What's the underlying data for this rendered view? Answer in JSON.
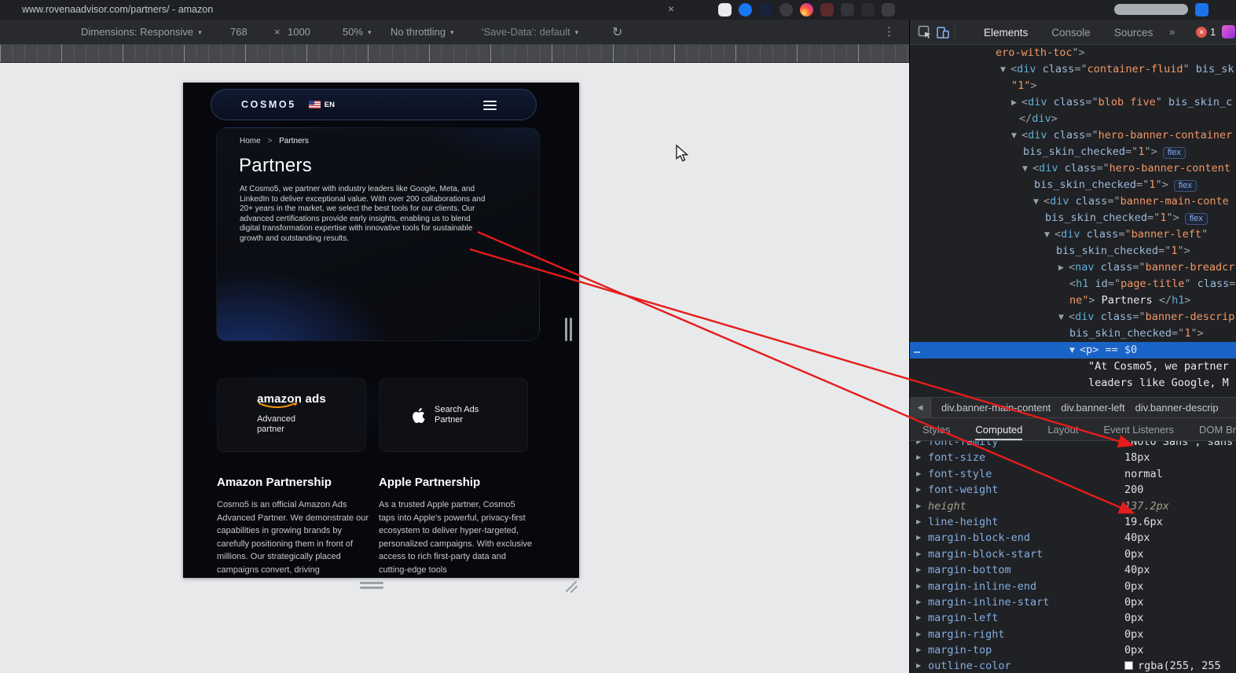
{
  "browser": {
    "tab_title": "www.rovenaadvisor.com/partners/ - amazon",
    "toolbar_icons": [
      {
        "name": "extension-icon-1",
        "color": "#e8eaed",
        "shape": "rounded"
      },
      {
        "name": "extension-icon-2",
        "color": "#1877f2",
        "shape": "circle"
      },
      {
        "name": "extension-icon-3",
        "color": "#16233a",
        "shape": "rounded"
      },
      {
        "name": "extension-icon-4",
        "color": "#3a3b3e",
        "shape": "circle"
      },
      {
        "name": "extension-icon-5",
        "color": "insta",
        "shape": "circle"
      },
      {
        "name": "extension-icon-6",
        "color": "#5c2a2a",
        "shape": "rounded"
      },
      {
        "name": "extension-icon-7",
        "color": "#33343a",
        "shape": "rounded"
      },
      {
        "name": "extension-icon-8",
        "color": "#2b2c30",
        "shape": "rounded"
      },
      {
        "name": "extension-icon-9",
        "color": "#3c3d41",
        "shape": "rounded"
      }
    ]
  },
  "icons": {
    "close": "×",
    "caret": "▾",
    "times": "×",
    "rotate": "↻",
    "menu_dots": "⋮",
    "more_tabs": "»",
    "back_arrow": "◀",
    "gutter_ellipsis": "…",
    "error_x": "✕"
  },
  "device_toolbar": {
    "dimensions_label": "Dimensions: Responsive",
    "width": "768",
    "height": "1000",
    "zoom": "50%",
    "throttling": "No throttling",
    "save_data": "'Save-Data': default"
  },
  "page": {
    "logo": "COSMO5",
    "flag_label": "EN",
    "breadcrumb": {
      "home": "Home",
      "separator": ">",
      "current": "Partners"
    },
    "title": "Partners",
    "intro": "At Cosmo5, we partner with industry leaders like Google, Meta, and LinkedIn to deliver exceptional value. With over 200 collaborations and 20+ years in the market, we select the best tools for our clients. Our advanced certifications provide early insights, enabling us to blend digital transformation expertise with innovative tools for sustainable growth and outstanding results.",
    "partner_cards": [
      {
        "logo_text": "amazon ads",
        "label": "Advanced partner"
      },
      {
        "logo_icon": "apple-logo",
        "label": "Search Ads Partner"
      }
    ],
    "sections": [
      {
        "heading": "Amazon Partnership",
        "body": "Cosmo5 is an official Amazon Ads Advanced Partner. We demonstrate our capabilities in growing brands by carefully positioning them in front of millions. Our strategically placed campaigns convert, driving"
      },
      {
        "heading": "Apple Partnership",
        "body": "As a trusted Apple partner, Cosmo5 taps into Apple's powerful, privacy-first ecosystem to deliver hyper-targeted, personalized campaigns. With exclusive access to rich first-party data and cutting-edge tools"
      }
    ]
  },
  "devtools": {
    "panel_tabs": [
      "Elements",
      "Console",
      "Sources"
    ],
    "selected_panel_tab": "Elements",
    "error_count": "1",
    "dom_lines": [
      {
        "indent": 109,
        "parts": [
          [
            "val",
            "ero-with-toc"
          ],
          [
            "p",
            "\">"
          ]
        ]
      },
      {
        "indent": 115,
        "parts": [
          [
            "sym",
            "▼"
          ],
          [
            "p",
            "<"
          ],
          [
            "tag",
            "div"
          ],
          [
            "p",
            " "
          ],
          [
            "attr",
            "class"
          ],
          [
            "p",
            "=\""
          ],
          [
            "val",
            "container-fluid"
          ],
          [
            "p",
            "\" "
          ],
          [
            "attr",
            "bis_sk"
          ]
        ]
      },
      {
        "indent": 129,
        "parts": [
          [
            "val",
            "\"1\""
          ],
          [
            "p",
            ">"
          ]
        ]
      },
      {
        "indent": 129,
        "parts": [
          [
            "sym",
            "▶"
          ],
          [
            "p",
            "<"
          ],
          [
            "tag",
            "div"
          ],
          [
            "p",
            " "
          ],
          [
            "attr",
            "class"
          ],
          [
            "p",
            "=\""
          ],
          [
            "val",
            "blob five"
          ],
          [
            "p",
            "\" "
          ],
          [
            "attr",
            "bis_skin_c"
          ]
        ]
      },
      {
        "indent": 139,
        "parts": [
          [
            "p",
            "</"
          ],
          [
            "tag",
            "div"
          ],
          [
            "p",
            ">"
          ]
        ]
      },
      {
        "indent": 129,
        "parts": [
          [
            "sym",
            "▼"
          ],
          [
            "p",
            "<"
          ],
          [
            "tag",
            "div"
          ],
          [
            "p",
            " "
          ],
          [
            "attr",
            "class"
          ],
          [
            "p",
            "=\""
          ],
          [
            "val",
            "hero-banner-container"
          ]
        ]
      },
      {
        "indent": 144,
        "parts": [
          [
            "attr",
            "bis_skin_checked"
          ],
          [
            "p",
            "=\""
          ],
          [
            "val",
            "1"
          ],
          [
            "p",
            "\">"
          ]
        ],
        "badge": "flex"
      },
      {
        "indent": 143,
        "parts": [
          [
            "sym",
            "▼"
          ],
          [
            "p",
            "<"
          ],
          [
            "tag",
            "div"
          ],
          [
            "p",
            " "
          ],
          [
            "attr",
            "class"
          ],
          [
            "p",
            "=\""
          ],
          [
            "val",
            "hero-banner-content"
          ]
        ]
      },
      {
        "indent": 158,
        "parts": [
          [
            "attr",
            "bis_skin_checked"
          ],
          [
            "p",
            "=\""
          ],
          [
            "val",
            "1"
          ],
          [
            "p",
            "\">"
          ]
        ],
        "badge": "flex"
      },
      {
        "indent": 157,
        "parts": [
          [
            "sym",
            "▼"
          ],
          [
            "p",
            "<"
          ],
          [
            "tag",
            "div"
          ],
          [
            "p",
            " "
          ],
          [
            "attr",
            "class"
          ],
          [
            "p",
            "=\""
          ],
          [
            "val",
            "banner-main-conte"
          ]
        ]
      },
      {
        "indent": 172,
        "parts": [
          [
            "attr",
            "bis_skin_checked"
          ],
          [
            "p",
            "=\""
          ],
          [
            "val",
            "1"
          ],
          [
            "p",
            "\">"
          ]
        ],
        "badge": "flex"
      },
      {
        "indent": 171,
        "parts": [
          [
            "sym",
            "▼"
          ],
          [
            "p",
            "<"
          ],
          [
            "tag",
            "div"
          ],
          [
            "p",
            " "
          ],
          [
            "attr",
            "class"
          ],
          [
            "p",
            "=\""
          ],
          [
            "val",
            "banner-left"
          ],
          [
            "p",
            "\""
          ]
        ]
      },
      {
        "indent": 186,
        "parts": [
          [
            "attr",
            "bis_skin_checked"
          ],
          [
            "p",
            "=\""
          ],
          [
            "val",
            "1"
          ],
          [
            "p",
            "\">"
          ]
        ]
      },
      {
        "indent": 189,
        "parts": [
          [
            "sym",
            "▶"
          ],
          [
            "p",
            "<"
          ],
          [
            "tag",
            "nav"
          ],
          [
            "p",
            " "
          ],
          [
            "attr",
            "class"
          ],
          [
            "p",
            "=\""
          ],
          [
            "val",
            "banner-breadcr"
          ]
        ]
      },
      {
        "indent": 203,
        "parts": [
          [
            "p",
            "<"
          ],
          [
            "tag",
            "h1"
          ],
          [
            "p",
            " "
          ],
          [
            "attr",
            "id"
          ],
          [
            "p",
            "=\""
          ],
          [
            "val",
            "page-title"
          ],
          [
            "p",
            "\" "
          ],
          [
            "attr",
            "class"
          ],
          [
            "p",
            "="
          ]
        ]
      },
      {
        "indent": 203,
        "parts": [
          [
            "val",
            "ne\""
          ],
          [
            "p",
            "> "
          ],
          [
            "txt",
            "Partners"
          ],
          [
            "p",
            " </"
          ],
          [
            "tag",
            "h1"
          ],
          [
            "p",
            ">"
          ]
        ]
      },
      {
        "indent": 189,
        "parts": [
          [
            "sym",
            "▼"
          ],
          [
            "p",
            "<"
          ],
          [
            "tag",
            "div"
          ],
          [
            "p",
            " "
          ],
          [
            "attr",
            "class"
          ],
          [
            "p",
            "=\""
          ],
          [
            "val",
            "banner-descrip"
          ]
        ]
      },
      {
        "indent": 203,
        "parts": [
          [
            "attr",
            "bis_skin_checked"
          ],
          [
            "p",
            "=\""
          ],
          [
            "val",
            "1"
          ],
          [
            "p",
            "\">"
          ]
        ]
      },
      {
        "indent": 203,
        "selected": true,
        "gutter": "…",
        "parts": [
          [
            "sym",
            "▼"
          ],
          [
            "p",
            "<"
          ],
          [
            "tag",
            "p"
          ],
          [
            "p",
            ">"
          ],
          [
            "note",
            " == $0"
          ]
        ]
      },
      {
        "indent": 227,
        "parts": [
          [
            "txt",
            "\"At Cosmo5, we partner"
          ]
        ]
      },
      {
        "indent": 227,
        "parts": [
          [
            "txt",
            "leaders like Google, M"
          ]
        ]
      }
    ],
    "crumbs": [
      "div.banner-main-content",
      "div.banner-left",
      "div.banner-descrip"
    ],
    "styles_tabs": [
      "Styles",
      "Computed",
      "Layout",
      "Event Listeners",
      "DOM Breakpoints"
    ],
    "selected_styles_tab": "Computed",
    "computed_properties": [
      {
        "name": "font-family",
        "value": "\"Noto Sans\", sans"
      },
      {
        "name": "font-size",
        "value": "18px"
      },
      {
        "name": "font-style",
        "value": "normal"
      },
      {
        "name": "font-weight",
        "value": "200"
      },
      {
        "name": "height",
        "value": "137.2px",
        "muted": true
      },
      {
        "name": "line-height",
        "value": "19.6px"
      },
      {
        "name": "margin-block-end",
        "value": "40px"
      },
      {
        "name": "margin-block-start",
        "value": "0px"
      },
      {
        "name": "margin-bottom",
        "value": "40px"
      },
      {
        "name": "margin-inline-end",
        "value": "0px"
      },
      {
        "name": "margin-inline-start",
        "value": "0px"
      },
      {
        "name": "margin-left",
        "value": "0px"
      },
      {
        "name": "margin-right",
        "value": "0px"
      },
      {
        "name": "margin-top",
        "value": "0px"
      },
      {
        "name": "outline-color",
        "value": "rgba(255, 255",
        "swatch": "#ffffff"
      }
    ]
  },
  "annotation_color": "#e51c1c"
}
